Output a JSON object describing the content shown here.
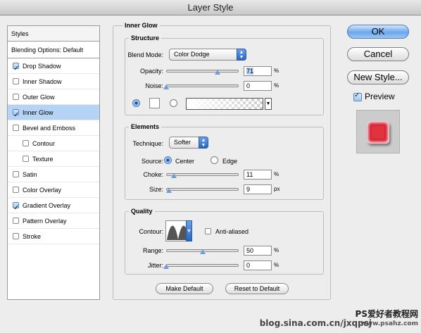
{
  "window": {
    "title": "Layer Style"
  },
  "sidebar": {
    "header": "Styles",
    "blending": "Blending Options: Default",
    "items": [
      {
        "label": "Drop Shadow",
        "checked": true,
        "indent": false,
        "selected": false
      },
      {
        "label": "Inner Shadow",
        "checked": false,
        "indent": false,
        "selected": false
      },
      {
        "label": "Outer Glow",
        "checked": false,
        "indent": false,
        "selected": false
      },
      {
        "label": "Inner Glow",
        "checked": true,
        "indent": false,
        "selected": true
      },
      {
        "label": "Bevel and Emboss",
        "checked": false,
        "indent": false,
        "selected": false
      },
      {
        "label": "Contour",
        "checked": false,
        "indent": true,
        "selected": false
      },
      {
        "label": "Texture",
        "checked": false,
        "indent": true,
        "selected": false
      },
      {
        "label": "Satin",
        "checked": false,
        "indent": false,
        "selected": false
      },
      {
        "label": "Color Overlay",
        "checked": false,
        "indent": false,
        "selected": false
      },
      {
        "label": "Gradient Overlay",
        "checked": true,
        "indent": false,
        "selected": false
      },
      {
        "label": "Pattern Overlay",
        "checked": false,
        "indent": false,
        "selected": false
      },
      {
        "label": "Stroke",
        "checked": false,
        "indent": false,
        "selected": false
      }
    ]
  },
  "panel": {
    "title": "Inner Glow",
    "structure": {
      "title": "Structure",
      "blend_mode_label": "Blend Mode:",
      "blend_mode": "Color Dodge",
      "opacity_label": "Opacity:",
      "opacity": "71",
      "opacity_unit": "%",
      "opacity_fraction": 0.71,
      "noise_label": "Noise:",
      "noise": "0",
      "noise_unit": "%",
      "noise_fraction": 0.0,
      "color_mode": "solid",
      "glow_color": "#ffffff"
    },
    "elements": {
      "title": "Elements",
      "technique_label": "Technique:",
      "technique": "Softer",
      "source_label": "Source:",
      "source_center": "Center",
      "source_edge": "Edge",
      "source_selected": "Center",
      "choke_label": "Choke:",
      "choke": "11",
      "choke_unit": "%",
      "choke_fraction": 0.11,
      "size_label": "Size:",
      "size": "9",
      "size_unit": "px",
      "size_fraction": 0.04
    },
    "quality": {
      "title": "Quality",
      "contour_label": "Contour:",
      "antialiased_label": "Anti-aliased",
      "antialiased": false,
      "range_label": "Range:",
      "range": "50",
      "range_unit": "%",
      "range_fraction": 0.5,
      "jitter_label": "Jitter:",
      "jitter": "0",
      "jitter_unit": "%",
      "jitter_fraction": 0.0
    },
    "make_default": "Make Default",
    "reset_default": "Reset to Default"
  },
  "buttons": {
    "ok": "OK",
    "cancel": "Cancel",
    "new_style": "New Style...",
    "preview_label": "Preview",
    "preview_checked": true
  },
  "watermark": {
    "line1": "PS爱好者教程网",
    "line2": "blog.sina.com.cn/jxqpsj",
    "line3": "www.psahz.com"
  }
}
